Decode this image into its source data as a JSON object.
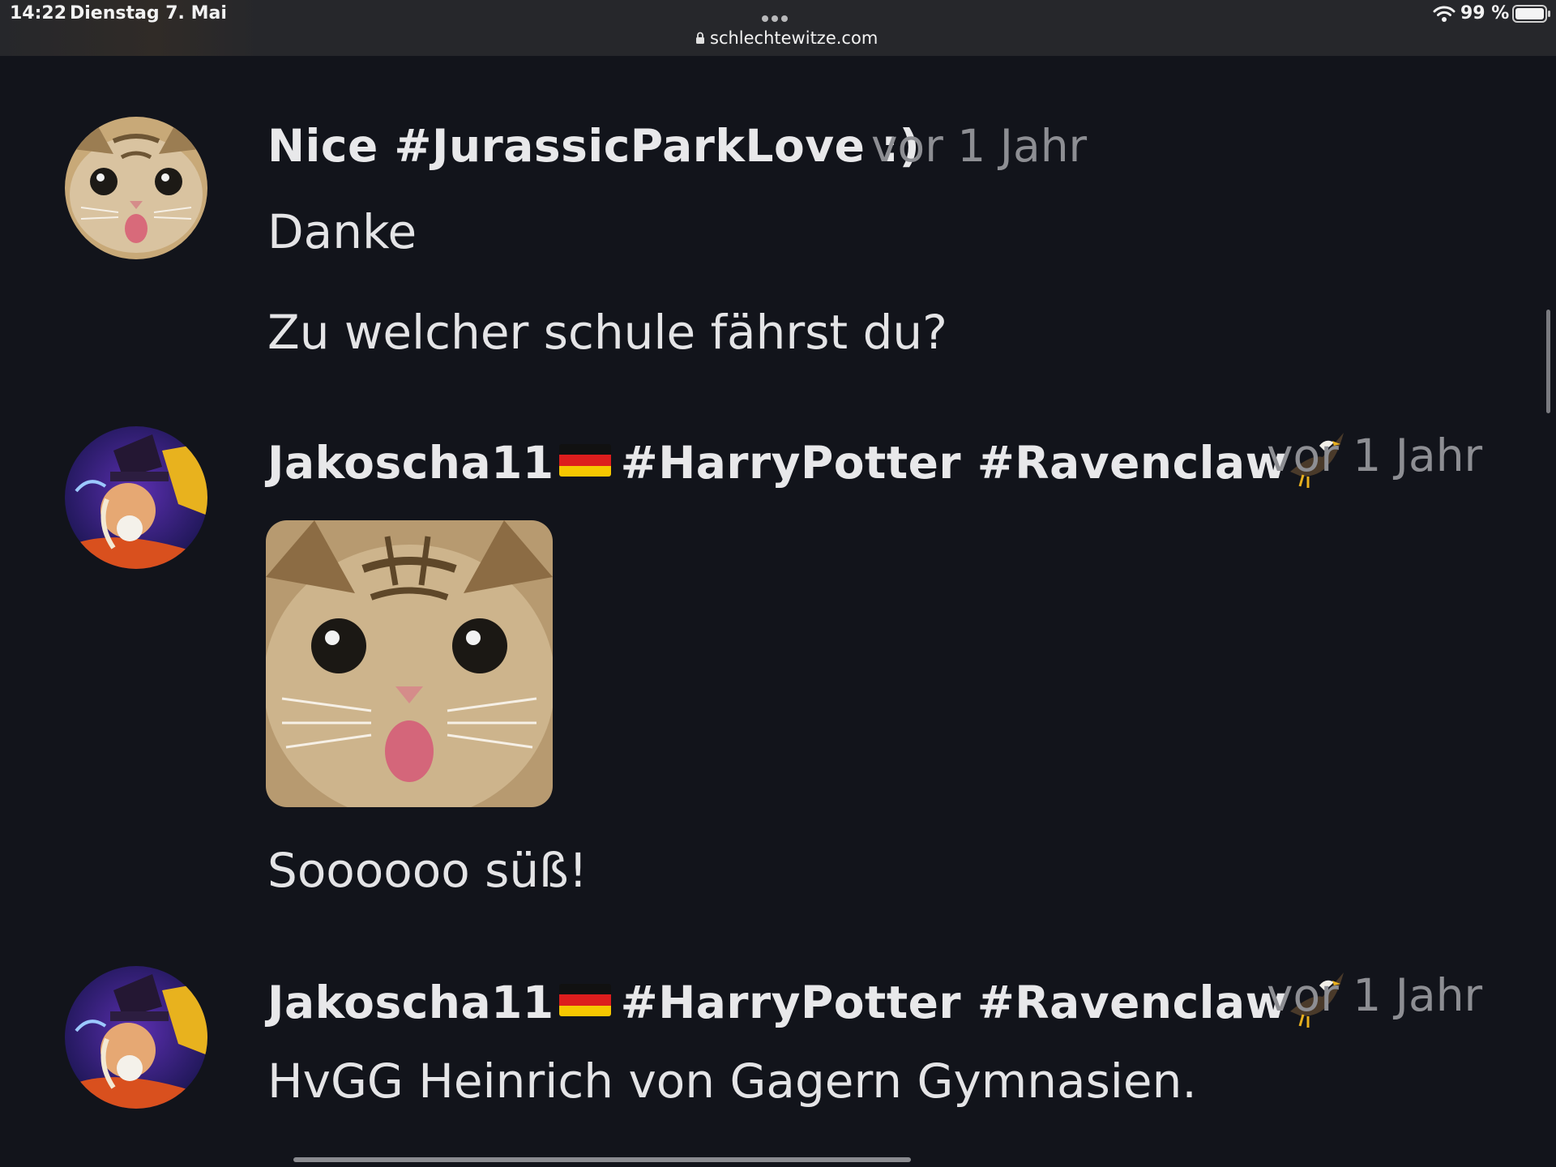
{
  "status_bar": {
    "time": "14:22",
    "date": "Dienstag 7. Mai",
    "url": "schlechtewitze.com",
    "battery": "99 %"
  },
  "comments": [
    {
      "author": "Nice #JurassicParkLove :)",
      "timestamp": "vor 1 Jahr",
      "avatar_icon": "cat-avatar",
      "texts": [
        "Danke",
        "Zu welcher schule fährst du?"
      ]
    },
    {
      "author_name": "Jakoscha11",
      "author_tags": "#HarryPotter #Ravenclaw",
      "flag_icon": "german-flag-icon",
      "emoji_icon": "eagle-icon",
      "timestamp": "vor 1 Jahr",
      "avatar_icon": "wizard-avatar",
      "image": "cat-photo",
      "texts": [
        "Soooooo süß!"
      ]
    },
    {
      "author_name": "Jakoscha11",
      "author_tags": "#HarryPotter #Ravenclaw",
      "flag_icon": "german-flag-icon",
      "emoji_icon": "eagle-icon",
      "timestamp": "vor 1 Jahr",
      "avatar_icon": "wizard-avatar",
      "texts": [
        "HvGG Heinrich von Gagern Gymnasien."
      ]
    }
  ],
  "colors": {
    "background": "#12141b",
    "status_bar": "#26272b",
    "author_text": "#e8e8ea",
    "timestamp_text": "#8d8e93"
  }
}
